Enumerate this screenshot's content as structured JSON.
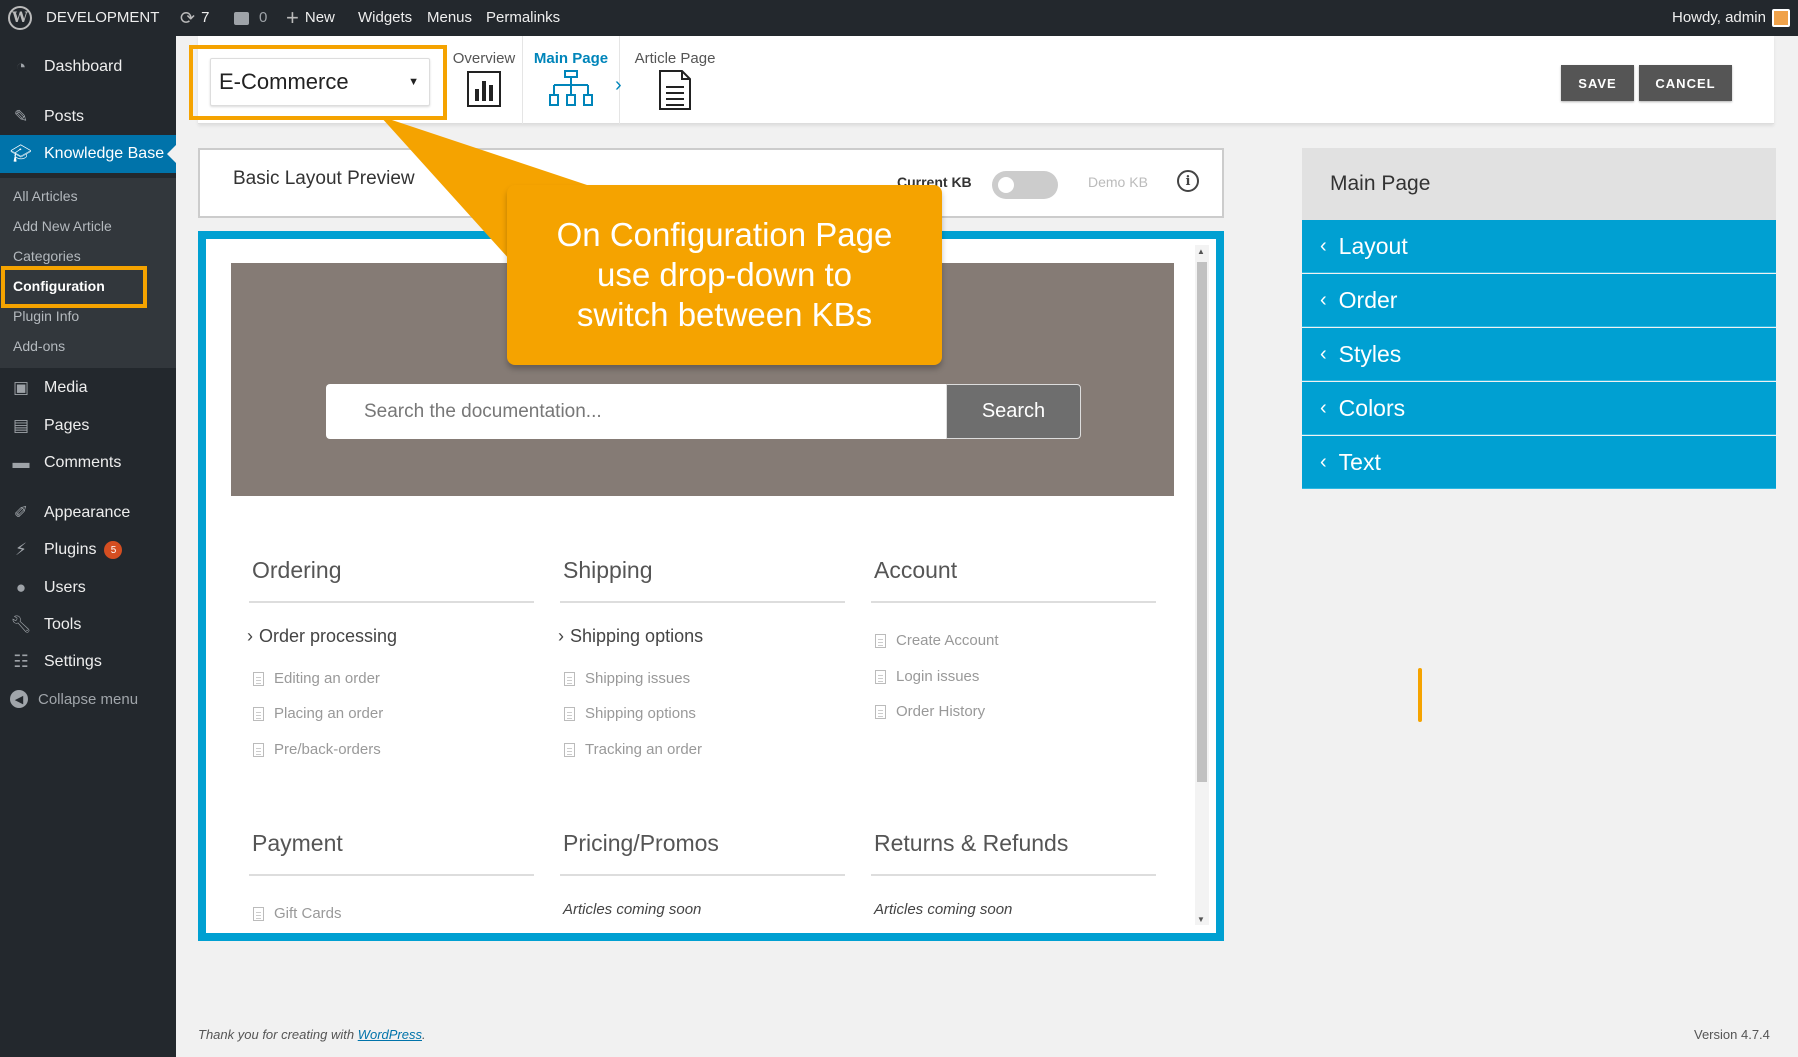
{
  "adminbar": {
    "site_name": "DEVELOPMENT",
    "updates_count": "7",
    "comments_count": "0",
    "new_label": "New",
    "widgets_label": "Widgets",
    "menus_label": "Menus",
    "permalinks_label": "Permalinks",
    "howdy": "Howdy, admin"
  },
  "sidebar": {
    "items": [
      {
        "label": "Dashboard",
        "icon": "dashboard-icon"
      },
      {
        "label": "Posts",
        "icon": "pin-icon"
      },
      {
        "label": "Knowledge Base",
        "icon": "graduation-cap-icon"
      },
      {
        "label": "Media",
        "icon": "media-icon"
      },
      {
        "label": "Pages",
        "icon": "page-icon"
      },
      {
        "label": "Comments",
        "icon": "comment-icon"
      },
      {
        "label": "Appearance",
        "icon": "brush-icon"
      },
      {
        "label": "Plugins",
        "icon": "plug-icon",
        "badge": "5"
      },
      {
        "label": "Users",
        "icon": "user-icon"
      },
      {
        "label": "Tools",
        "icon": "wrench-icon"
      },
      {
        "label": "Settings",
        "icon": "settings-icon"
      }
    ],
    "submenu": [
      "All Articles",
      "Add New Article",
      "Categories",
      "Configuration",
      "Plugin Info",
      "Add-ons"
    ],
    "collapse_label": "Collapse menu"
  },
  "config": {
    "kb_select_value": "E-Commerce",
    "tabs": [
      "Overview",
      "Main Page",
      "Article Page"
    ],
    "save_label": "SAVE",
    "cancel_label": "CANCEL"
  },
  "preview": {
    "title": "Basic Layout Preview",
    "current_kb_label": "Current KB",
    "demo_kb_label": "Demo KB",
    "info_glyph": "i",
    "search_placeholder": "Search the documentation...",
    "search_button": "Search",
    "categories": [
      {
        "title": "Ordering",
        "sub": "Order processing",
        "articles": [
          "Editing an order",
          "Placing an order",
          "Pre/back-orders"
        ]
      },
      {
        "title": "Shipping",
        "sub": "Shipping options",
        "articles": [
          "Shipping issues",
          "Shipping options",
          "Tracking an order"
        ]
      },
      {
        "title": "Account",
        "articles": [
          "Create Account",
          "Login issues",
          "Order History"
        ]
      },
      {
        "title": "Payment",
        "articles": [
          "Gift Cards"
        ]
      },
      {
        "title": "Pricing/Promos",
        "coming": "Articles coming soon"
      },
      {
        "title": "Returns & Refunds",
        "coming": "Articles coming soon"
      }
    ]
  },
  "panel": {
    "title": "Main Page",
    "items": [
      "Layout",
      "Order",
      "Styles",
      "Colors",
      "Text"
    ]
  },
  "callout": {
    "line1": "On Configuration Page",
    "line2": "use drop-down to",
    "line3": "switch between KBs"
  },
  "footer": {
    "thanks_prefix": "Thank you for creating with ",
    "wordpress_link": "WordPress",
    "thanks_suffix": ".",
    "version": "Version 4.7.4"
  },
  "colors": {
    "accent": "#00a0d2",
    "wp_blue": "#0073aa",
    "callout": "#f5a300",
    "sidebar": "#23282d"
  }
}
